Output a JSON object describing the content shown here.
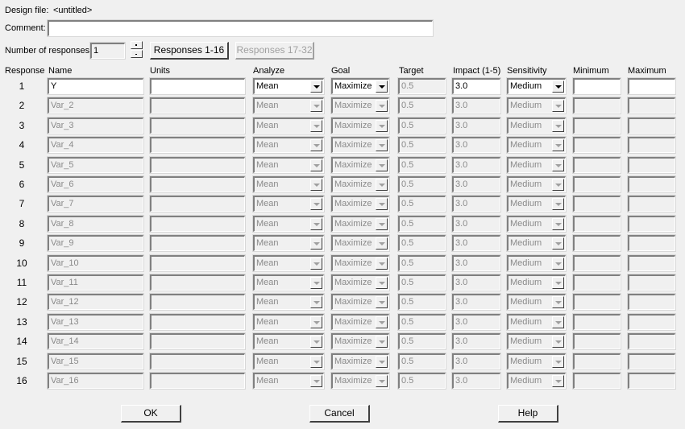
{
  "design_file": {
    "label": "Design file:",
    "value": "<untitled>"
  },
  "comment": {
    "label": "Comment:",
    "value": ""
  },
  "num_responses": {
    "label": "Number of responses:",
    "value": "1"
  },
  "page_buttons": {
    "page1": "Responses 1-16",
    "page2": "Responses 17-32"
  },
  "headers": {
    "response": "Response",
    "name": "Name",
    "units": "Units",
    "analyze": "Analyze",
    "goal": "Goal",
    "target": "Target",
    "impact": "Impact (1-5)",
    "sensitivity": "Sensitivity",
    "minimum": "Minimum",
    "maximum": "Maximum"
  },
  "rows": [
    {
      "num": "1",
      "name": "Y",
      "units": "",
      "analyze": "Mean",
      "goal": "Maximize",
      "target": "0.5",
      "impact": "3.0",
      "sensitivity": "Medium",
      "minimum": "",
      "maximum": "",
      "enabled": true
    },
    {
      "num": "2",
      "name": "Var_2",
      "units": "",
      "analyze": "Mean",
      "goal": "Maximize",
      "target": "0.5",
      "impact": "3.0",
      "sensitivity": "Medium",
      "minimum": "",
      "maximum": "",
      "enabled": false
    },
    {
      "num": "3",
      "name": "Var_3",
      "units": "",
      "analyze": "Mean",
      "goal": "Maximize",
      "target": "0.5",
      "impact": "3.0",
      "sensitivity": "Medium",
      "minimum": "",
      "maximum": "",
      "enabled": false
    },
    {
      "num": "4",
      "name": "Var_4",
      "units": "",
      "analyze": "Mean",
      "goal": "Maximize",
      "target": "0.5",
      "impact": "3.0",
      "sensitivity": "Medium",
      "minimum": "",
      "maximum": "",
      "enabled": false
    },
    {
      "num": "5",
      "name": "Var_5",
      "units": "",
      "analyze": "Mean",
      "goal": "Maximize",
      "target": "0.5",
      "impact": "3.0",
      "sensitivity": "Medium",
      "minimum": "",
      "maximum": "",
      "enabled": false
    },
    {
      "num": "6",
      "name": "Var_6",
      "units": "",
      "analyze": "Mean",
      "goal": "Maximize",
      "target": "0.5",
      "impact": "3.0",
      "sensitivity": "Medium",
      "minimum": "",
      "maximum": "",
      "enabled": false
    },
    {
      "num": "7",
      "name": "Var_7",
      "units": "",
      "analyze": "Mean",
      "goal": "Maximize",
      "target": "0.5",
      "impact": "3.0",
      "sensitivity": "Medium",
      "minimum": "",
      "maximum": "",
      "enabled": false
    },
    {
      "num": "8",
      "name": "Var_8",
      "units": "",
      "analyze": "Mean",
      "goal": "Maximize",
      "target": "0.5",
      "impact": "3.0",
      "sensitivity": "Medium",
      "minimum": "",
      "maximum": "",
      "enabled": false
    },
    {
      "num": "9",
      "name": "Var_9",
      "units": "",
      "analyze": "Mean",
      "goal": "Maximize",
      "target": "0.5",
      "impact": "3.0",
      "sensitivity": "Medium",
      "minimum": "",
      "maximum": "",
      "enabled": false
    },
    {
      "num": "10",
      "name": "Var_10",
      "units": "",
      "analyze": "Mean",
      "goal": "Maximize",
      "target": "0.5",
      "impact": "3.0",
      "sensitivity": "Medium",
      "minimum": "",
      "maximum": "",
      "enabled": false
    },
    {
      "num": "11",
      "name": "Var_11",
      "units": "",
      "analyze": "Mean",
      "goal": "Maximize",
      "target": "0.5",
      "impact": "3.0",
      "sensitivity": "Medium",
      "minimum": "",
      "maximum": "",
      "enabled": false
    },
    {
      "num": "12",
      "name": "Var_12",
      "units": "",
      "analyze": "Mean",
      "goal": "Maximize",
      "target": "0.5",
      "impact": "3.0",
      "sensitivity": "Medium",
      "minimum": "",
      "maximum": "",
      "enabled": false
    },
    {
      "num": "13",
      "name": "Var_13",
      "units": "",
      "analyze": "Mean",
      "goal": "Maximize",
      "target": "0.5",
      "impact": "3.0",
      "sensitivity": "Medium",
      "minimum": "",
      "maximum": "",
      "enabled": false
    },
    {
      "num": "14",
      "name": "Var_14",
      "units": "",
      "analyze": "Mean",
      "goal": "Maximize",
      "target": "0.5",
      "impact": "3.0",
      "sensitivity": "Medium",
      "minimum": "",
      "maximum": "",
      "enabled": false
    },
    {
      "num": "15",
      "name": "Var_15",
      "units": "",
      "analyze": "Mean",
      "goal": "Maximize",
      "target": "0.5",
      "impact": "3.0",
      "sensitivity": "Medium",
      "minimum": "",
      "maximum": "",
      "enabled": false
    },
    {
      "num": "16",
      "name": "Var_16",
      "units": "",
      "analyze": "Mean",
      "goal": "Maximize",
      "target": "0.5",
      "impact": "3.0",
      "sensitivity": "Medium",
      "minimum": "",
      "maximum": "",
      "enabled": false
    }
  ],
  "footer": {
    "ok": "OK",
    "cancel": "Cancel",
    "help": "Help"
  }
}
